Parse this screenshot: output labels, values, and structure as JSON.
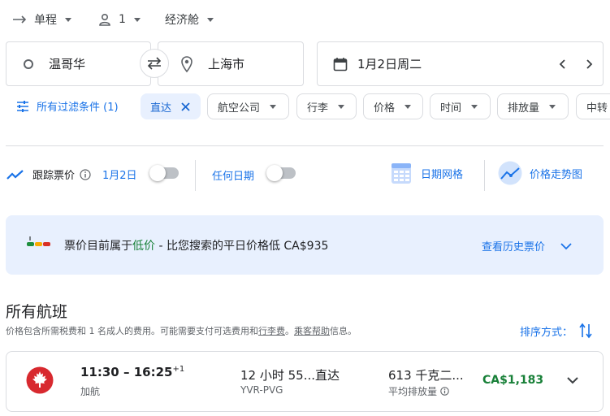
{
  "top_bar": {
    "trip_type": "单程",
    "passengers": "1",
    "cabin_class": "经济舱"
  },
  "search": {
    "origin": "温哥华",
    "destination": "上海市",
    "date": "1月2日周二"
  },
  "filters": {
    "all_filters": "所有过滤条件 (1)",
    "active_chip": "直达",
    "chips": [
      "航空公司",
      "行李",
      "价格",
      "时间",
      "排放量",
      "中转"
    ]
  },
  "tracking": {
    "label": "跟踪票价",
    "date_label": "1月2日",
    "any_date_label": "任何日期",
    "date_grid": "日期网格",
    "price_graph": "价格走势图"
  },
  "price_insight": {
    "text_before": "票价目前属于",
    "highlight": "低价",
    "text_after": " - 比您搜索的平日价格低 CA$935",
    "history_link": "查看历史票价"
  },
  "results": {
    "title": "所有航班",
    "note_1": "价格包含所需税费和 1 名成人的费用。可能需要支付可选费用和",
    "note_link_1": "行李费",
    "note_2": "。",
    "note_link_2": "乘客帮助",
    "note_3": "信息。",
    "sort_label": "排序方式："
  },
  "flight": {
    "times": "11:30 – 16:25",
    "day_offset": "+1",
    "airline": "加航",
    "duration": "12 小时 55...",
    "stops": "直达",
    "route": "YVR-PVG",
    "emissions": "613 千克二...",
    "emissions_label": "平均排放量",
    "price": "CA$1,183"
  },
  "colors": {
    "accent_blue": "#1a73e8",
    "price_green": "#188038",
    "air_canada_red": "#d8292f",
    "insight_bg": "#e8f0fe"
  }
}
